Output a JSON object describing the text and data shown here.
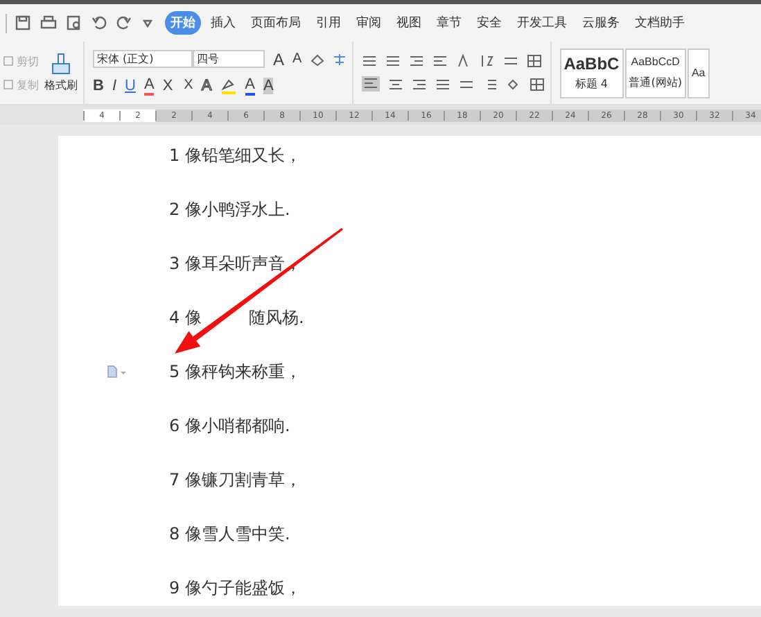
{
  "quick_access": {
    "tabs": [
      {
        "label": "开始",
        "selected": true
      },
      {
        "label": "插入",
        "selected": false
      },
      {
        "label": "页面布局",
        "selected": false
      },
      {
        "label": "引用",
        "selected": false
      },
      {
        "label": "审阅",
        "selected": false
      },
      {
        "label": "视图",
        "selected": false
      },
      {
        "label": "章节",
        "selected": false
      },
      {
        "label": "安全",
        "selected": false
      },
      {
        "label": "开发工具",
        "selected": false
      },
      {
        "label": "云服务",
        "selected": false
      },
      {
        "label": "文档助手",
        "selected": false
      }
    ]
  },
  "ribbon": {
    "clipboard": [
      {
        "label": "剪切",
        "disabled": true
      },
      {
        "label": "复制",
        "disabled": true
      }
    ],
    "format_painter": "格式刷",
    "font_name": "宋体 (正文)",
    "font_size": "四号",
    "font_row1": [
      {
        "kind": "grow",
        "label": "A"
      },
      {
        "kind": "shrink",
        "label": "A"
      }
    ],
    "font_row2": [
      {
        "kind": "bold",
        "label": "B"
      },
      {
        "kind": "italic",
        "label": "I"
      },
      {
        "kind": "underline",
        "label": "U"
      },
      {
        "kind": "strike",
        "label": "A"
      },
      {
        "kind": "super",
        "label": "X"
      },
      {
        "kind": "sub",
        "label": "X"
      },
      {
        "kind": "outline",
        "label": "A"
      },
      {
        "kind": "color",
        "label": "A"
      },
      {
        "kind": "shade",
        "label": "A"
      }
    ],
    "styles": [
      {
        "sample": "AaBbC",
        "name": "标题 4",
        "kind": "heading"
      },
      {
        "sample": "AaBbCcD",
        "name": "普通(网站)",
        "kind": "normal"
      },
      {
        "sample": "Aa",
        "kind": "cut"
      }
    ]
  },
  "ruler": {
    "labels": [
      "4",
      "2",
      "2",
      "4",
      "6",
      "8",
      "10",
      "12",
      "14",
      "16",
      "18",
      "20",
      "22",
      "24",
      "26",
      "28",
      "30",
      "32",
      "34"
    ]
  },
  "document": {
    "lines": [
      {
        "text": "1 像铅笔细又长，",
        "marker": false
      },
      {
        "text": "2 像小鸭浮水上.",
        "marker": false
      },
      {
        "text": "3 像耳朵听声音，",
        "marker": false
      },
      {
        "text": "4 像",
        "text_after_arrow": "随风杨.",
        "marker": false
      },
      {
        "text": "5 像秤钩来称重，",
        "marker": true
      },
      {
        "text": "6 像小哨都都响.",
        "marker": false
      },
      {
        "text": "7 像镰刀割青草，",
        "marker": false
      },
      {
        "text": "8 像雪人雪中笑.",
        "marker": false
      },
      {
        "text": "9 像勺子能盛饭，",
        "marker": false
      }
    ]
  }
}
